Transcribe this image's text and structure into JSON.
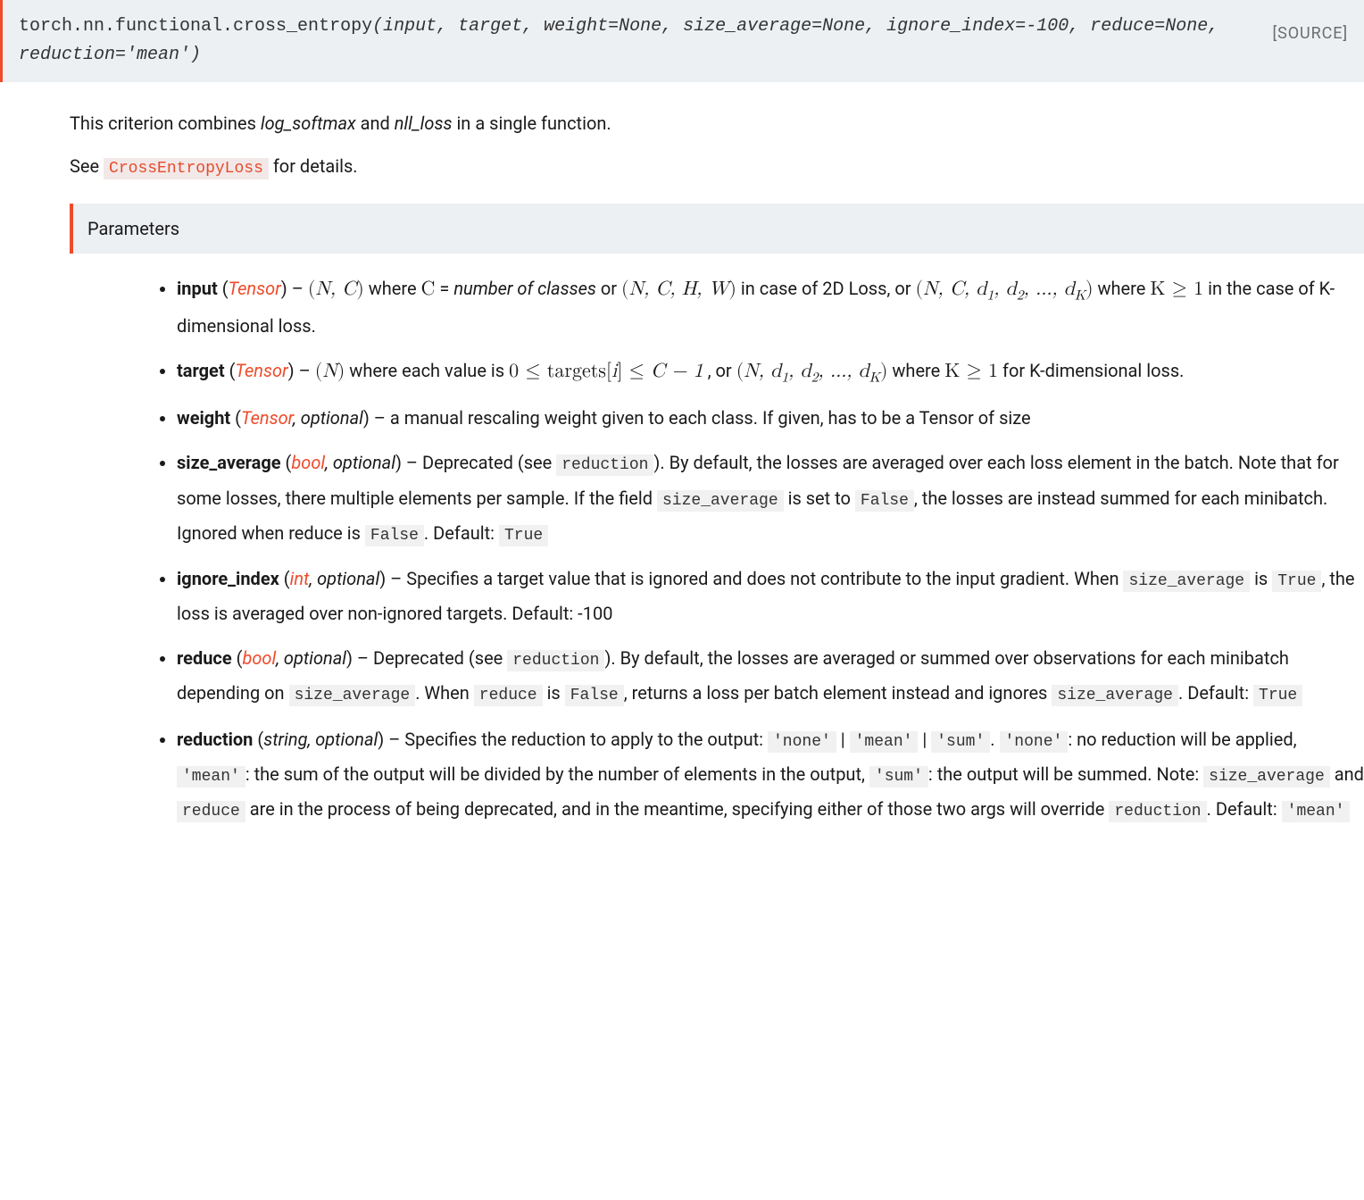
{
  "signature": {
    "prefix": "torch.nn.functional.",
    "name": "cross_entropy",
    "args": "(input, target, weight=None, size_average=None, ignore_index=-100, reduce=None, reduction='mean')",
    "source": "[SOURCE]"
  },
  "intro": {
    "pre": "This criterion combines ",
    "em1": "log_softmax",
    "mid": " and ",
    "em2": "nll_loss",
    "post": " in a single function."
  },
  "see": {
    "pre": "See ",
    "ref": "CrossEntropyLoss",
    "post": " for details."
  },
  "params_header": "Parameters",
  "params": {
    "input": {
      "name": "input",
      "type": "Tensor",
      "d1": " – ",
      "m1_open": "(",
      "m1_vars": "N, C",
      "m1_close": ")",
      "t1": " where ",
      "math_c": "C",
      "eq": " = ",
      "noc": "number of classes",
      "or1": " or ",
      "m2_open": "(",
      "m2_vars": "N, C, H, W",
      "m2_close": ")",
      "t2": " in case of 2D Loss, or ",
      "m3_open": "(",
      "m3_vars": "N, C, d",
      "m3_sub1": "1",
      "m3_c1": ", d",
      "m3_sub2": "2",
      "m3_c2": ", ..., d",
      "m3_subK": "K",
      "m3_close": ")",
      "t3": " where ",
      "m4": "K ≥ 1",
      "t4": " in the case of K-dimensional loss."
    },
    "target": {
      "name": "target",
      "type": "Tensor",
      "d1": " – ",
      "m1_open": "(",
      "m1_vars": "N",
      "m1_close": ")",
      "t1": " where each value is ",
      "m2a": "0 ≤ targets[",
      "m2i": "i",
      "m2b": "] ≤ ",
      "m2c": "C − 1",
      "t2": " , or ",
      "m3_open": "(",
      "m3_vars": "N, d",
      "m3_sub1": "1",
      "m3_c1": ", d",
      "m3_sub2": "2",
      "m3_c2": ", ..., d",
      "m3_subK": "K",
      "m3_close": ")",
      "t3": " where ",
      "m4": "K ≥ 1",
      "t4": " for K-dimensional loss."
    },
    "weight": {
      "name": "weight",
      "type": "Tensor",
      "opt": ", optional",
      "desc": " – a manual rescaling weight given to each class. If given, has to be a Tensor of size"
    },
    "size_average": {
      "name": "size_average",
      "type": "bool",
      "opt": ", optional",
      "d1": " – Deprecated (see ",
      "c1": "reduction",
      "d2": "). By default, the losses are averaged over each loss element in the batch. Note that for some losses, there multiple elements per sample. If the field ",
      "c2": "size_average",
      "d3": " is set to ",
      "c3": "False",
      "d4": ", the losses are instead summed for each minibatch. Ignored when reduce is ",
      "c4": "False",
      "d5": ". Default: ",
      "c5": "True"
    },
    "ignore_index": {
      "name": "ignore_index",
      "type": "int",
      "opt": ", optional",
      "d1": " – Specifies a target value that is ignored and does not contribute to the input gradient. When ",
      "c1": "size_average",
      "d2": " is ",
      "c2": "True",
      "d3": ", the loss is averaged over non-ignored targets. Default: -100"
    },
    "reduce": {
      "name": "reduce",
      "type": "bool",
      "opt": ", optional",
      "d1": " – Deprecated (see ",
      "c1": "reduction",
      "d2": "). By default, the losses are averaged or summed over observations for each minibatch depending on ",
      "c2": "size_average",
      "d3": ". When ",
      "c3": "reduce",
      "d4": " is ",
      "c4": "False",
      "d5": ", returns a loss per batch element instead and ignores ",
      "c5": "size_average",
      "d6": ". Default: ",
      "c6": "True"
    },
    "reduction": {
      "name": "reduction",
      "type": "string",
      "opt": ", optional",
      "d1": " – Specifies the reduction to apply to the output: ",
      "c1": "'none'",
      "sep1": " | ",
      "c2": "'mean'",
      "sep2": " | ",
      "c3": "'sum'",
      "d2": ". ",
      "c4": "'none'",
      "d3": ": no reduction will be applied, ",
      "c5": "'mean'",
      "d4": ": the sum of the output will be divided by the number of elements in the output, ",
      "c6": "'sum'",
      "d5": ": the output will be summed. Note: ",
      "c7": "size_average",
      "d6": " and ",
      "c8": "reduce",
      "d7": " are in the process of being deprecated, and in the meantime, specifying either of those two args will override ",
      "c9": "reduction",
      "d8": ". Default: ",
      "c10": "'mean'"
    }
  }
}
